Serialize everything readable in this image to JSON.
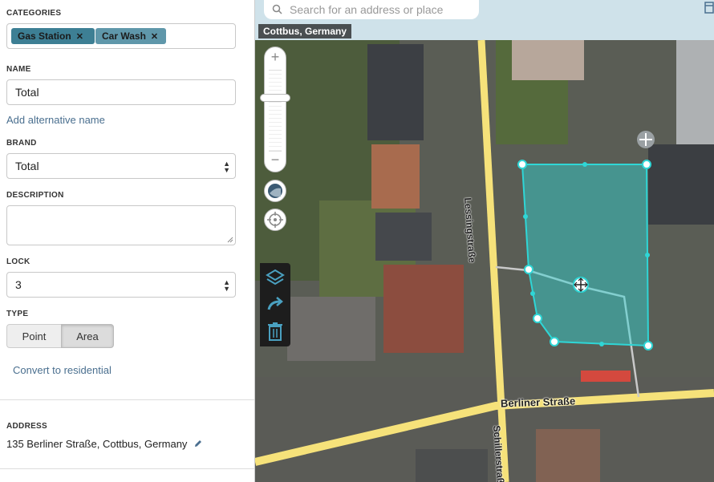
{
  "sidebar": {
    "categories_label": "CATEGORIES",
    "categories": [
      {
        "name": "Gas Station",
        "color": "#3d7f94"
      },
      {
        "name": "Car Wash",
        "color": "#5f97aa"
      }
    ],
    "remove_glyph": "✕",
    "name_label": "NAME",
    "name_value": "Total",
    "add_alt_name": "Add alternative name",
    "brand_label": "BRAND",
    "brand_value": "Total",
    "description_label": "DESCRIPTION",
    "description_value": "",
    "lock_label": "LOCK",
    "lock_value": "3",
    "type_label": "TYPE",
    "type_options": [
      "Point",
      "Area"
    ],
    "type_selected": "Area",
    "convert_link": "Convert to residential",
    "address_label": "ADDRESS",
    "address_value": "135 Berliner Straße, Cottbus, Germany"
  },
  "map": {
    "search_placeholder": "Search for an address or place",
    "location": "Cottbus, Germany",
    "streets": [
      {
        "name": "Lessingstraße"
      },
      {
        "name": "Berliner Straße"
      },
      {
        "name": "Schillerstraße"
      }
    ],
    "zoom_in": "+",
    "zoom_out": "−",
    "selection_color": "#2fd6d6",
    "road_color": "#f6e27a"
  }
}
